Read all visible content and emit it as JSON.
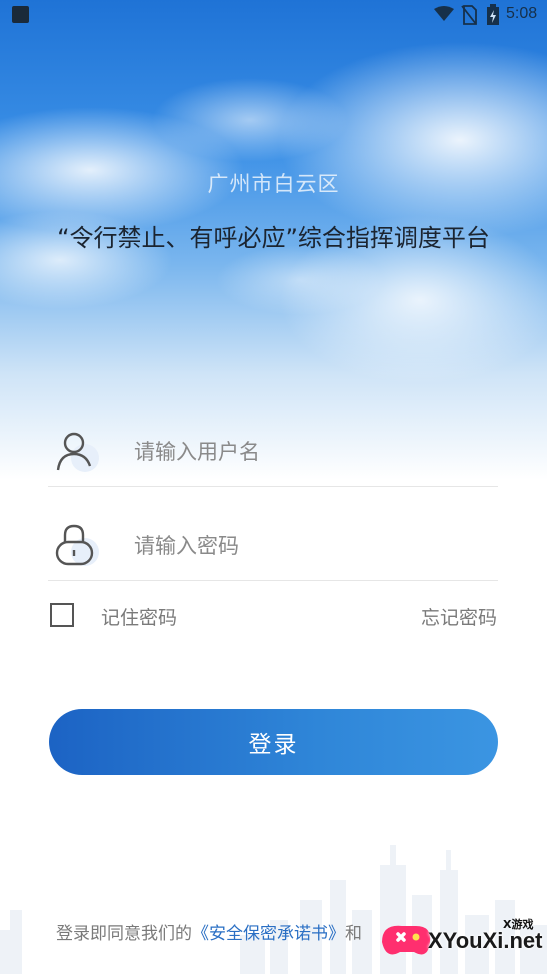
{
  "status_bar": {
    "time": "5:08",
    "icons": [
      "app-icon",
      "wifi-icon",
      "no-sim-icon",
      "battery-icon"
    ]
  },
  "header": {
    "district": "广州市白云区",
    "platform_title": "“令行禁止、有呼必应”综合指挥调度平台"
  },
  "form": {
    "username": {
      "placeholder": "请输入用户名",
      "value": "",
      "icon": "user-icon"
    },
    "password": {
      "placeholder": "请输入密码",
      "value": "",
      "icon": "lock-icon"
    },
    "remember_label": "记住密码",
    "remember_checked": false,
    "forgot_label": "忘记密码",
    "login_label": "登录"
  },
  "agreement": {
    "prefix": "登录即同意我们的",
    "link": "《安全保密承诺书》",
    "suffix": "和"
  },
  "watermark": {
    "brand": "XYouXi.net",
    "tag": "X游戏"
  },
  "colors": {
    "accent": "#2a7ad2",
    "link": "#2a6fc4",
    "button_start": "#1c63c4",
    "button_end": "#3b95e2"
  }
}
